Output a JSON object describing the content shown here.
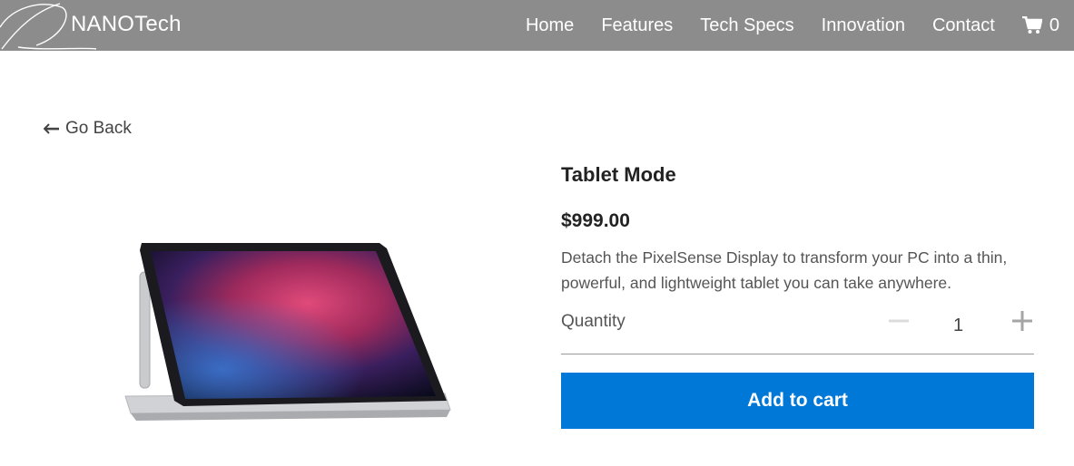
{
  "brand": {
    "name": "NANOTech"
  },
  "nav": {
    "links": [
      "Home",
      "Features",
      "Tech Specs",
      "Innovation",
      "Contact"
    ],
    "cart_count": "0"
  },
  "go_back": {
    "label": "Go Back"
  },
  "product": {
    "title": "Tablet Mode",
    "price": "$999.00",
    "description": "Detach the PixelSense Display to transform your PC into a thin, powerful, and lightweight tablet you can take anywhere.",
    "quantity_label": "Quantity",
    "quantity": "1",
    "add_to_cart_label": "Add to cart"
  },
  "icons": {
    "cart": "shopping-cart-icon",
    "back": "arrow-left-icon",
    "minus": "minus-icon",
    "plus": "plus-icon"
  },
  "colors": {
    "navbar": "#8c8c8c",
    "accent": "#0078d7"
  }
}
